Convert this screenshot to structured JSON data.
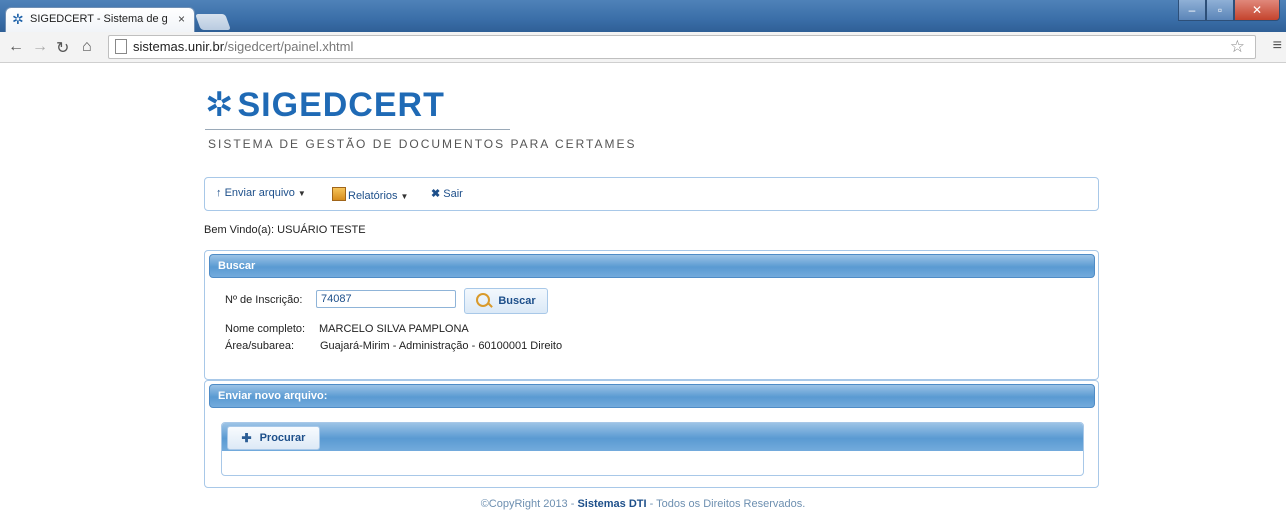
{
  "browser": {
    "tab_title": "SIGEDCERT - Sistema de g",
    "tab_close": "×",
    "url_host": "sistemas.unir.br",
    "url_path": "/sigedcert/painel.xhtml",
    "back_icon": "back-arrow-icon",
    "forward_icon": "forward-arrow-icon",
    "reload_icon": "reload-icon",
    "home_icon": "home-icon"
  },
  "header": {
    "logo_text": "SIGEDCERT",
    "tagline": "SISTEMA DE GESTÃO DE DOCUMENTOS PARA CERTAMES",
    "brand_color": "#1f6ab5"
  },
  "menu": {
    "items": [
      {
        "label": "Enviar arquivo",
        "icon": "upload-arrow-icon",
        "has_dropdown": true
      },
      {
        "label": "Relatórios",
        "icon": "reports-icon",
        "has_dropdown": true
      },
      {
        "label": "Sair",
        "icon": "close-x-icon",
        "has_dropdown": false
      }
    ]
  },
  "welcome": "Bem Vindo(a): USUÁRIO TESTE",
  "search_panel": {
    "title": "Buscar",
    "inscription_label": "Nº de Inscrição:",
    "inscription_value": "74087",
    "search_button": "Buscar",
    "name_label": "Nome completo:",
    "name_value": "MARCELO SILVA PAMPLONA",
    "area_label": "Área/subarea:",
    "area_value": "Guajará-Mirim - Administração - 60100001 Direito"
  },
  "upload_panel": {
    "title": "Enviar novo arquivo:",
    "browse_button": "Procurar"
  },
  "footer": {
    "prefix": "©CopyRight 2013 - ",
    "brand": "Sistemas DTI",
    "suffix": " - Todos os Direitos Reservados."
  }
}
